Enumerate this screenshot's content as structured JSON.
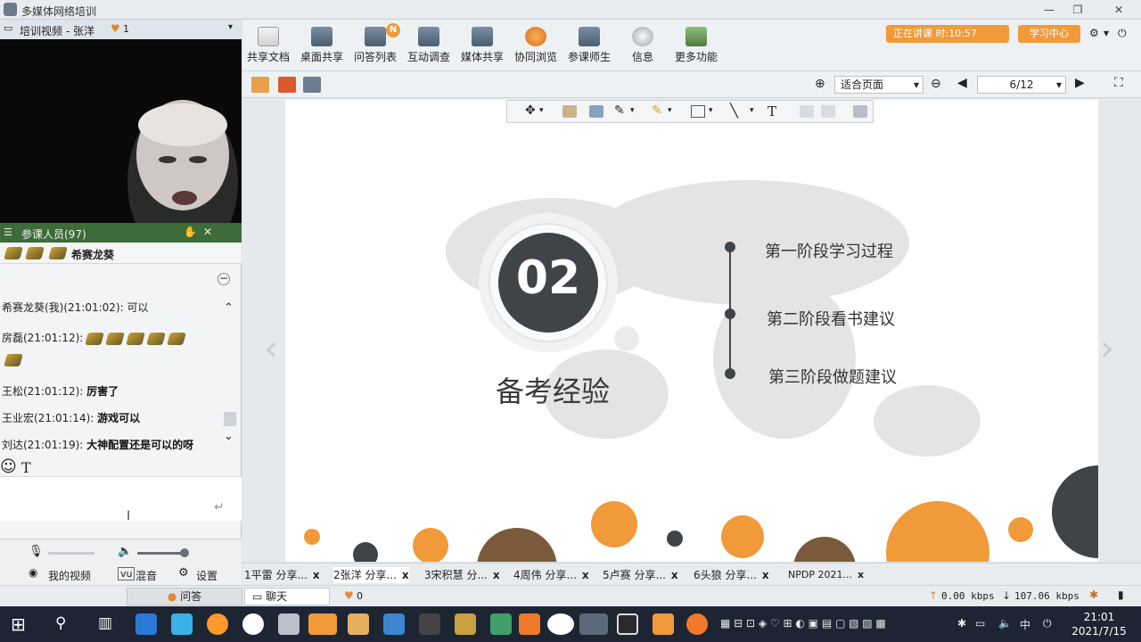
{
  "window": {
    "title": "多媒体网络培训"
  },
  "video": {
    "header": "培训视频 - 张洋",
    "header_count": "1",
    "attendees": "参课人员(97)"
  },
  "chat": {
    "current_user": "希赛龙葵",
    "messages": [
      {
        "sender": "希赛龙葵(我)(21:01:02):",
        "text": "可以",
        "bold": false
      },
      {
        "sender": "房磊(21:01:12):",
        "text": "",
        "bold": false
      },
      {
        "sender": "王松(21:01:12):",
        "text": "厉害了",
        "bold": true
      },
      {
        "sender": "王业宏(21:01:14):",
        "text": "游戏可以",
        "bold": true
      },
      {
        "sender": "刘达(21:01:19):",
        "text": "大神配置还是可以的呀",
        "bold": true
      }
    ],
    "text_tool": "T"
  },
  "media": {
    "my_video": "我的视频",
    "mix": "混音",
    "settings": "设置"
  },
  "left_tabs": {
    "qa": "问答",
    "chat": "聊天",
    "likes": "0"
  },
  "toolbar": {
    "items": [
      "共享文档",
      "桌面共享",
      "问答列表",
      "互动调查",
      "媒体共享",
      "协同浏览",
      "参课师生",
      "信息",
      "更多功能"
    ],
    "badge": "N",
    "status": "正在讲课 时:10:57",
    "sign": "学习中心"
  },
  "navbar": {
    "zoom": "适合页面",
    "page": "6/12"
  },
  "slide": {
    "number": "02",
    "title": "备考经验",
    "steps": [
      "第一阶段学习过程",
      "第二阶段看书建议",
      "第三阶段做题建议"
    ]
  },
  "file_tabs": [
    "1平雷 分享...",
    "2张洋 分享...",
    "3宋积慧 分...",
    "4周伟 分享...",
    "5卢赛 分享...",
    "6头狼 分享...",
    "NPDP 2021..."
  ],
  "statusbar": {
    "upload": "0.00 kbps",
    "download": "107.06 kbps"
  },
  "taskbar": {
    "time": "21:01",
    "date": "2021/7/15",
    "ime": "中"
  },
  "colors": {
    "accent": "#f09a3a",
    "dark_circle": "#3f4448"
  }
}
